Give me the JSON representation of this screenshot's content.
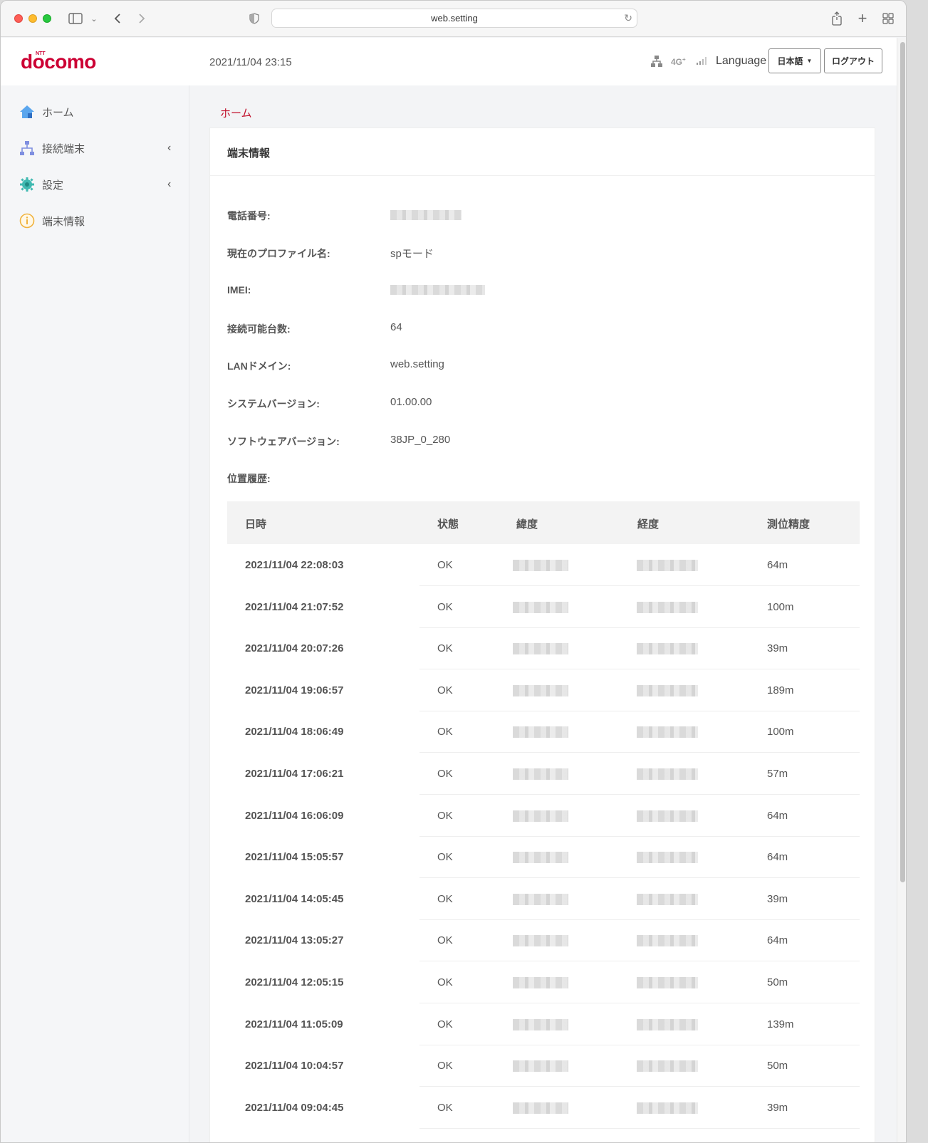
{
  "browser": {
    "address": "web.setting"
  },
  "logo": {
    "ntt": "NTT",
    "brand": "docomo"
  },
  "header": {
    "datetime": "2021/11/04 23:15",
    "network_badge": "4G",
    "network_badge_sup": "+",
    "language_label": "Language",
    "language_select": "日本語",
    "logout": "ログアウト"
  },
  "sidebar": {
    "items": [
      {
        "label": "ホーム",
        "icon": "home-icon",
        "has_chevron": false
      },
      {
        "label": "接続端末",
        "icon": "network-tree-icon",
        "has_chevron": true
      },
      {
        "label": "設定",
        "icon": "gear-icon",
        "has_chevron": true
      },
      {
        "label": "端末情報",
        "icon": "info-icon",
        "has_chevron": false
      }
    ]
  },
  "breadcrumb": "ホーム",
  "card": {
    "title": "端末情報",
    "fields": [
      {
        "label": "電話番号:",
        "value": "",
        "blurred": true
      },
      {
        "label": "現在のプロファイル名:",
        "value": "spモード",
        "blurred": false
      },
      {
        "label": "IMEI:",
        "value": "",
        "blurred": true
      },
      {
        "label": "接続可能台数:",
        "value": "64",
        "blurred": false
      },
      {
        "label": "LANドメイン:",
        "value": "web.setting",
        "blurred": false
      },
      {
        "label": "システムバージョン:",
        "value": "01.00.00",
        "blurred": false
      },
      {
        "label": "ソフトウェアバージョン:",
        "value": "38JP_0_280",
        "blurred": false
      },
      {
        "label": "位置履歴:",
        "value": "",
        "blurred": false
      }
    ],
    "history": {
      "headers": [
        "日時",
        "状態",
        "緯度",
        "経度",
        "測位精度"
      ],
      "rows": [
        {
          "datetime": "2021/11/04 22:08:03",
          "status": "OK",
          "accuracy": "64m"
        },
        {
          "datetime": "2021/11/04 21:07:52",
          "status": "OK",
          "accuracy": "100m"
        },
        {
          "datetime": "2021/11/04 20:07:26",
          "status": "OK",
          "accuracy": "39m"
        },
        {
          "datetime": "2021/11/04 19:06:57",
          "status": "OK",
          "accuracy": "189m"
        },
        {
          "datetime": "2021/11/04 18:06:49",
          "status": "OK",
          "accuracy": "100m"
        },
        {
          "datetime": "2021/11/04 17:06:21",
          "status": "OK",
          "accuracy": "57m"
        },
        {
          "datetime": "2021/11/04 16:06:09",
          "status": "OK",
          "accuracy": "64m"
        },
        {
          "datetime": "2021/11/04 15:05:57",
          "status": "OK",
          "accuracy": "64m"
        },
        {
          "datetime": "2021/11/04 14:05:45",
          "status": "OK",
          "accuracy": "39m"
        },
        {
          "datetime": "2021/11/04 13:05:27",
          "status": "OK",
          "accuracy": "64m"
        },
        {
          "datetime": "2021/11/04 12:05:15",
          "status": "OK",
          "accuracy": "50m"
        },
        {
          "datetime": "2021/11/04 11:05:09",
          "status": "OK",
          "accuracy": "139m"
        },
        {
          "datetime": "2021/11/04 10:04:57",
          "status": "OK",
          "accuracy": "50m"
        },
        {
          "datetime": "2021/11/04 09:04:45",
          "status": "OK",
          "accuracy": "39m"
        }
      ]
    }
  },
  "colors": {
    "brand": "#cc0033",
    "breadcrumb": "#c1112c",
    "home_icon": "#3b8fe0",
    "tree_icon": "#7f8fe0",
    "gear_icon": "#3fb9b1",
    "info_icon": "#f0b23c"
  }
}
